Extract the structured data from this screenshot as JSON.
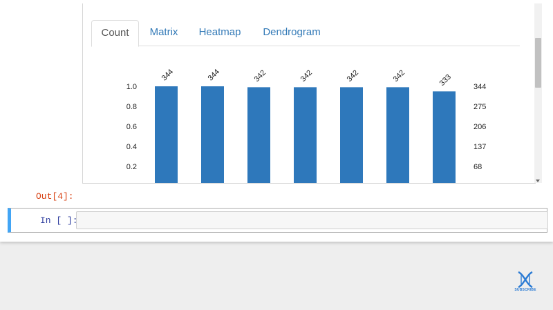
{
  "tabs": [
    {
      "label": "Count"
    },
    {
      "label": "Matrix"
    },
    {
      "label": "Heatmap"
    },
    {
      "label": "Dendrogram"
    }
  ],
  "active_tab": "Count",
  "cells": {
    "out_prompt": "Out[4]:",
    "in_prompt": "In [ ]:"
  },
  "subscribe_label": "SUBSCRIBE",
  "chart_data": {
    "type": "bar",
    "bar_color": "#2e78bb",
    "values": [
      344,
      344,
      342,
      342,
      342,
      342,
      333
    ],
    "value_labels": [
      "344",
      "344",
      "342",
      "342",
      "342",
      "342",
      "333"
    ],
    "left_axis_ticks": [
      "1.0",
      "0.8",
      "0.6",
      "0.4",
      "0.2"
    ],
    "right_axis_ticks": [
      "344",
      "275",
      "206",
      "137",
      "68"
    ],
    "ymax": 344
  }
}
